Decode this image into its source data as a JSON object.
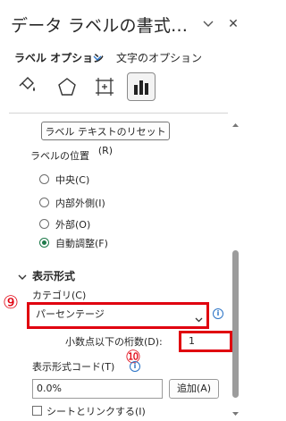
{
  "panel": {
    "title": "データ ラベルの書式…",
    "close_label": "✕"
  },
  "tabs": {
    "label_options": "ラベル オプション",
    "text_options": "文字のオプション"
  },
  "icons": {
    "fill": "fill-line-icon",
    "effects": "effects-pentagon-icon",
    "size": "size-properties-icon",
    "label_options": "bar-chart-icon"
  },
  "reset": {
    "label": "ラベル テキストのリセット(R)"
  },
  "label_position": {
    "heading": "ラベルの位置",
    "options": [
      {
        "label": "中央(C)",
        "checked": false
      },
      {
        "label": "内部外側(I)",
        "checked": false
      },
      {
        "label": "外部(O)",
        "checked": false
      },
      {
        "label": "自動調整(F)",
        "checked": true
      }
    ]
  },
  "number_format": {
    "heading": "表示形式",
    "category_label": "カテゴリ(C)",
    "category_value": "パーセンテージ",
    "decimal_label": "小数点以下の桁数(D):",
    "decimal_value": "1",
    "format_code_label": "表示形式コード(T)",
    "format_code_value": "0.0%",
    "add_button": "追加(A)",
    "link_label": "シートとリンクする(I)"
  },
  "annotations": {
    "nine": "⑨",
    "ten": "⑩"
  },
  "colors": {
    "accent_red": "#e0000f",
    "radio_green": "#1e7a4a",
    "info_blue": "#2b73c6"
  }
}
